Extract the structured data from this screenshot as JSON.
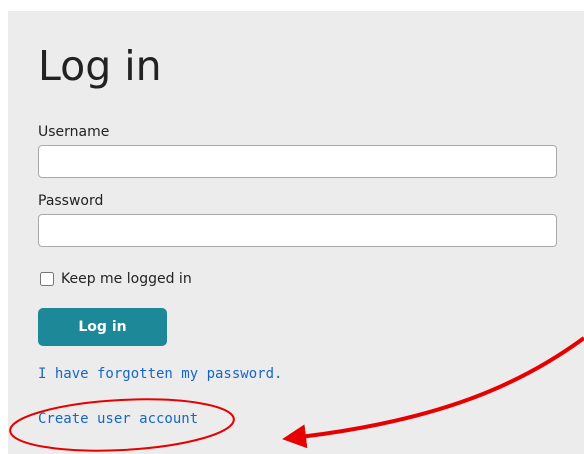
{
  "login": {
    "title": "Log in",
    "username_label": "Username",
    "username_value": "",
    "password_label": "Password",
    "password_value": "",
    "remember_label": "Keep me logged in",
    "remember_checked": false,
    "submit_label": "Log in",
    "forgot_link": "I have forgotten my password.",
    "create_link": "Create user account"
  },
  "colors": {
    "panel_background": "#ececec",
    "button": "#1c8898",
    "link": "#1766c6",
    "annotation": "#e60000"
  },
  "annotation": {
    "highlight_shape": "ellipse",
    "pointer_shape": "arrow"
  }
}
